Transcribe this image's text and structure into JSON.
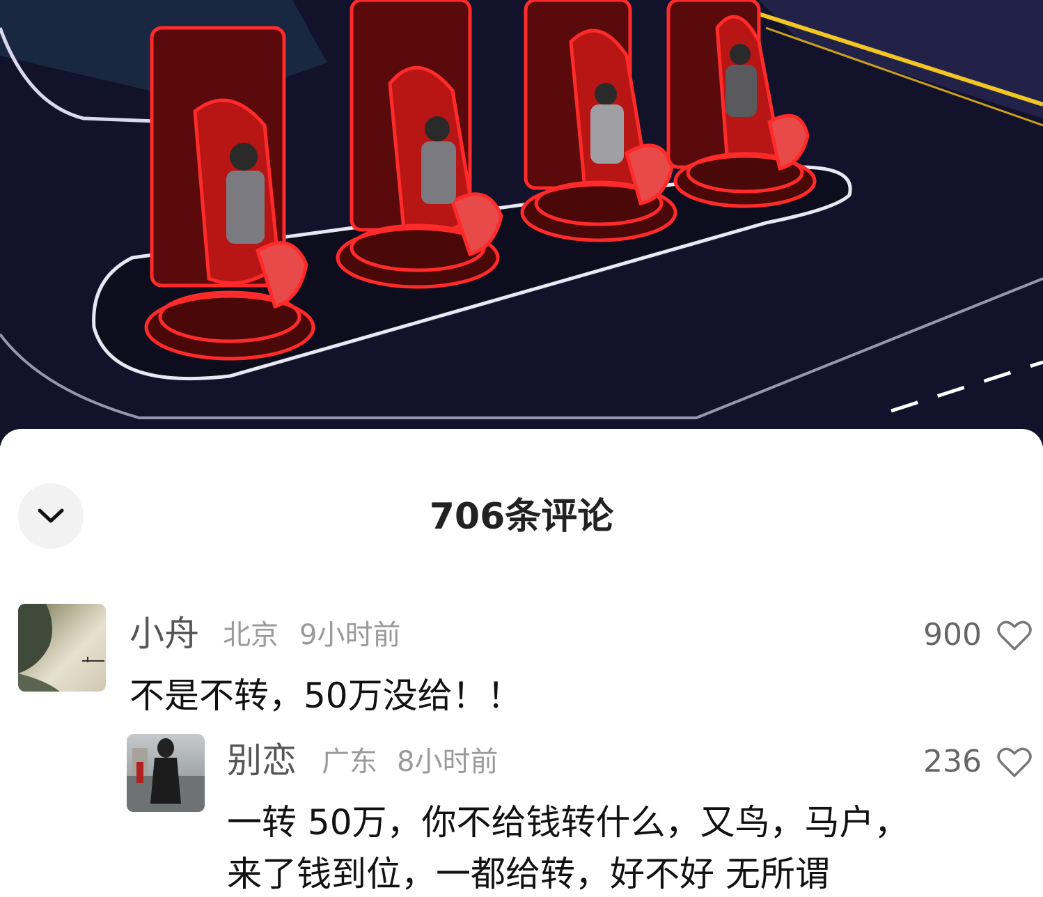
{
  "video": {
    "scene_icon": "stage-chairs-image"
  },
  "header": {
    "title": "706条评论",
    "collapse_icon": "chevron-down-icon"
  },
  "comments": [
    {
      "user": "小舟",
      "location": "北京",
      "time": "9小时前",
      "likes": "900",
      "text": "不是不转，50万没给！！"
    },
    {
      "user": "别恋",
      "location": "广东",
      "time": "8小时前",
      "likes": "236",
      "text_line1": "一转 50万，你不给钱转什么，又鸟，马户，",
      "text_line2": "来了钱到位，一都给转，好不好 无所谓"
    }
  ],
  "colors": {
    "neon_red": "#ff2a2a",
    "stage_dark": "#141428",
    "sheet_bg": "#ffffff"
  }
}
